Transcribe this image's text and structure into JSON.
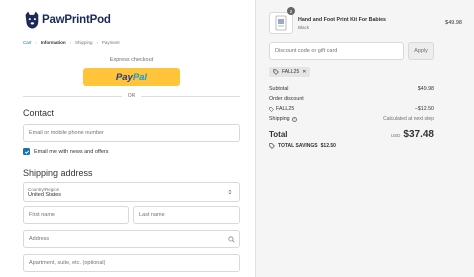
{
  "brand": {
    "name": "PawPrintPod"
  },
  "breadcrumb": [
    "Cart",
    "Information",
    "Shipping",
    "Payment"
  ],
  "express": {
    "label": "Express checkout",
    "paypal_1": "Pay",
    "paypal_2": "Pal"
  },
  "or_label": "OR",
  "contact": {
    "heading": "Contact",
    "email_placeholder": "Email or mobile phone number",
    "news_label": "Email me with news and offers",
    "news_checked": true
  },
  "shipping_address": {
    "heading": "Shipping address",
    "country_label": "Country/Region",
    "country_value": "United States",
    "first_name": "First name",
    "last_name": "Last name",
    "address": "Address",
    "apartment": "Apartment, suite, etc. (optional)"
  },
  "order": {
    "product": {
      "quantity": "2",
      "name": "Hand and Foot Print Kit For Babies",
      "variant": "Black",
      "price": "$49.98"
    },
    "discount_placeholder": "Discount code or gift card",
    "apply_label": "Apply",
    "applied_code": "FALL25",
    "subtotal_label": "Subtotal",
    "subtotal_value": "$49.98",
    "order_discount_label": "Order discount",
    "code_label": "FALL25",
    "code_value": "−$12.50",
    "shipping_label": "Shipping",
    "shipping_value": "Calculated at next step",
    "total_label": "Total",
    "total_currency": "USD",
    "total_value": "$37.48",
    "savings_label": "TOTAL SAVINGS",
    "savings_value": "$12.50"
  },
  "colors": {
    "accent": "#1773b0",
    "paypal": "#ffc439",
    "brand": "#1d2a57"
  }
}
